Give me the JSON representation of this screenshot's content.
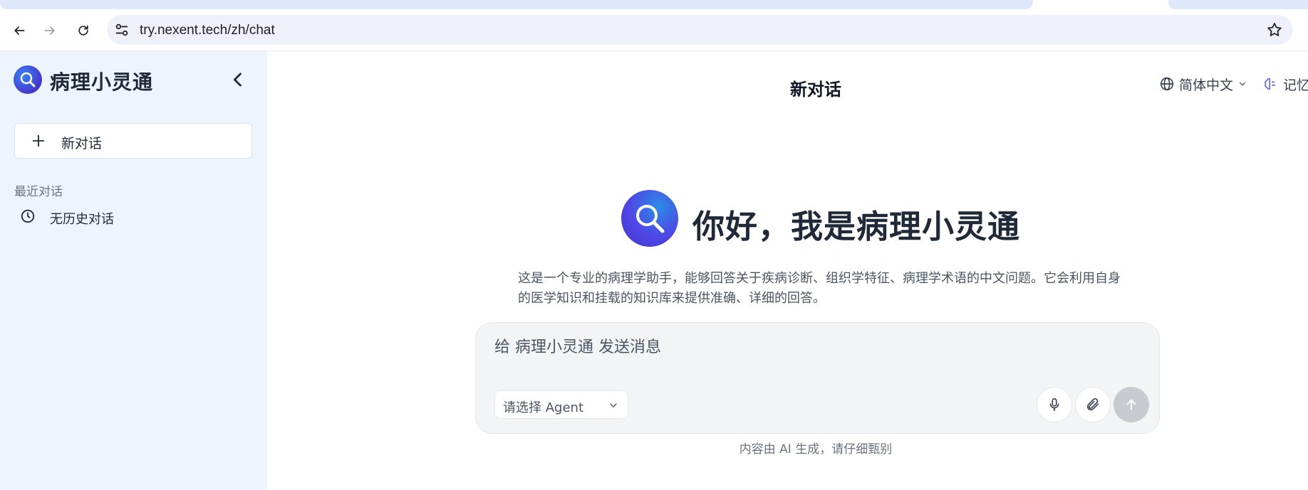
{
  "browser": {
    "url": "try.nexent.tech/zh/chat"
  },
  "sidebar": {
    "brand": "病理小灵通",
    "new_chat_label": "新对话",
    "recent_title": "最近对话",
    "history": [
      {
        "label": "无历史对话"
      }
    ]
  },
  "header": {
    "title": "新对话",
    "language": "简体中文",
    "memory": "记忆"
  },
  "hero": {
    "title": "你好，我是病理小灵通",
    "description": "这是一个专业的病理学助手，能够回答关于疾病诊断、组织学特征、病理学术语的中文问题。它会利用自身的医学知识和挂载的知识库来提供准确、详细的回答。"
  },
  "composer": {
    "placeholder": "给 病理小灵通 发送消息",
    "agent_select": "请选择 Agent"
  },
  "footer": {
    "note": "内容由 AI 生成，请仔细甄别"
  },
  "colors": {
    "sidebar_bg": "#eef4fd",
    "accent": "#4f46e5",
    "send_disabled": "#c7cad1"
  }
}
